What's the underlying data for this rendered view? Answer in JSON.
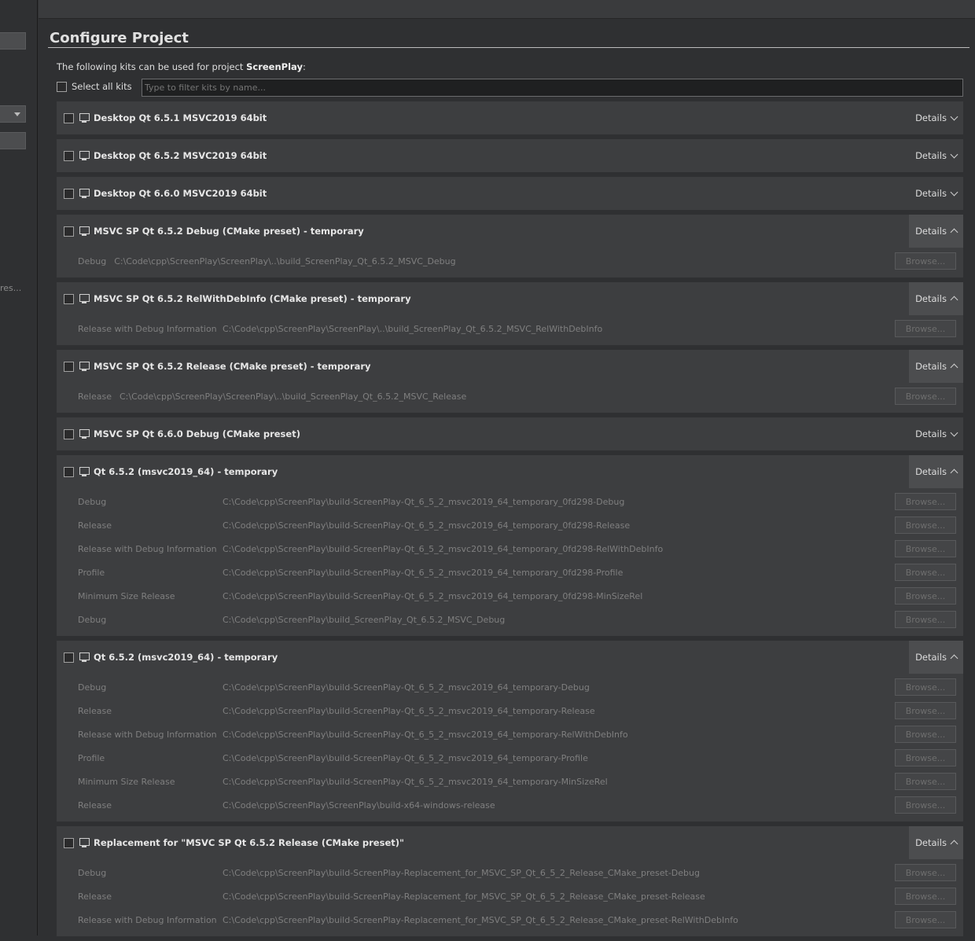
{
  "left_pane": {
    "truncated_text": "res..."
  },
  "page": {
    "title": "Configure Project",
    "intro_prefix": "The following kits can be used for project ",
    "project_name": "ScreenPlay",
    "intro_suffix": ":",
    "select_all_label": "Select all kits",
    "filter_placeholder": "Type to filter kits by name..."
  },
  "details_label": "Details",
  "browse_label": "Browse...",
  "kits": [
    {
      "name": "Desktop Qt 6.5.1 MSVC2019 64bit",
      "expanded": false,
      "configs": []
    },
    {
      "name": "Desktop Qt 6.5.2 MSVC2019 64bit",
      "expanded": false,
      "configs": []
    },
    {
      "name": "Desktop Qt 6.6.0 MSVC2019 64bit",
      "expanded": false,
      "configs": []
    },
    {
      "name": "MSVC SP Qt 6.5.2 Debug (CMake preset) - temporary",
      "expanded": true,
      "inline": true,
      "configs": [
        {
          "type": "Debug",
          "path": "C:\\Code\\cpp\\ScreenPlay\\ScreenPlay\\..\\build_ScreenPlay_Qt_6.5.2_MSVC_Debug"
        }
      ]
    },
    {
      "name": "MSVC SP Qt 6.5.2 RelWithDebInfo (CMake preset) - temporary",
      "expanded": true,
      "inline": false,
      "configs": [
        {
          "type": "Release with Debug Information",
          "path": "C:\\Code\\cpp\\ScreenPlay\\ScreenPlay\\..\\build_ScreenPlay_Qt_6.5.2_MSVC_RelWithDebInfo"
        }
      ]
    },
    {
      "name": "MSVC SP Qt 6.5.2 Release (CMake preset) - temporary",
      "expanded": true,
      "inline": true,
      "configs": [
        {
          "type": "Release",
          "path": "C:\\Code\\cpp\\ScreenPlay\\ScreenPlay\\..\\build_ScreenPlay_Qt_6.5.2_MSVC_Release"
        }
      ]
    },
    {
      "name": "MSVC SP Qt 6.6.0 Debug (CMake preset)",
      "expanded": false,
      "configs": []
    },
    {
      "name": "Qt 6.5.2 (msvc2019_64) - temporary",
      "expanded": true,
      "inline": false,
      "configs": [
        {
          "type": "Debug",
          "path": "C:\\Code\\cpp\\ScreenPlay\\build-ScreenPlay-Qt_6_5_2_msvc2019_64_temporary_0fd298-Debug"
        },
        {
          "type": "Release",
          "path": "C:\\Code\\cpp\\ScreenPlay\\build-ScreenPlay-Qt_6_5_2_msvc2019_64_temporary_0fd298-Release"
        },
        {
          "type": "Release with Debug Information",
          "path": "C:\\Code\\cpp\\ScreenPlay\\build-ScreenPlay-Qt_6_5_2_msvc2019_64_temporary_0fd298-RelWithDebInfo"
        },
        {
          "type": "Profile",
          "path": "C:\\Code\\cpp\\ScreenPlay\\build-ScreenPlay-Qt_6_5_2_msvc2019_64_temporary_0fd298-Profile"
        },
        {
          "type": "Minimum Size Release",
          "path": "C:\\Code\\cpp\\ScreenPlay\\build-ScreenPlay-Qt_6_5_2_msvc2019_64_temporary_0fd298-MinSizeRel"
        },
        {
          "type": "Debug",
          "path": "C:\\Code\\cpp\\ScreenPlay\\build_ScreenPlay_Qt_6.5.2_MSVC_Debug"
        }
      ]
    },
    {
      "name": "Qt 6.5.2 (msvc2019_64) - temporary",
      "expanded": true,
      "inline": false,
      "configs": [
        {
          "type": "Debug",
          "path": "C:\\Code\\cpp\\ScreenPlay\\build-ScreenPlay-Qt_6_5_2_msvc2019_64_temporary-Debug"
        },
        {
          "type": "Release",
          "path": "C:\\Code\\cpp\\ScreenPlay\\build-ScreenPlay-Qt_6_5_2_msvc2019_64_temporary-Release"
        },
        {
          "type": "Release with Debug Information",
          "path": "C:\\Code\\cpp\\ScreenPlay\\build-ScreenPlay-Qt_6_5_2_msvc2019_64_temporary-RelWithDebInfo"
        },
        {
          "type": "Profile",
          "path": "C:\\Code\\cpp\\ScreenPlay\\build-ScreenPlay-Qt_6_5_2_msvc2019_64_temporary-Profile"
        },
        {
          "type": "Minimum Size Release",
          "path": "C:\\Code\\cpp\\ScreenPlay\\build-ScreenPlay-Qt_6_5_2_msvc2019_64_temporary-MinSizeRel"
        },
        {
          "type": "Release",
          "path": "C:\\Code\\cpp\\ScreenPlay\\ScreenPlay\\build-x64-windows-release"
        }
      ]
    },
    {
      "name": "Replacement for \"MSVC SP Qt 6.5.2 Release (CMake preset)\"",
      "expanded": true,
      "inline": false,
      "configs": [
        {
          "type": "Debug",
          "path": "C:\\Code\\cpp\\ScreenPlay\\build-ScreenPlay-Replacement_for_MSVC_SP_Qt_6_5_2_Release_CMake_preset-Debug"
        },
        {
          "type": "Release",
          "path": "C:\\Code\\cpp\\ScreenPlay\\build-ScreenPlay-Replacement_for_MSVC_SP_Qt_6_5_2_Release_CMake_preset-Release"
        },
        {
          "type": "Release with Debug Information",
          "path": "C:\\Code\\cpp\\ScreenPlay\\build-ScreenPlay-Replacement_for_MSVC_SP_Qt_6_5_2_Release_CMake_preset-RelWithDebInfo"
        }
      ]
    }
  ]
}
